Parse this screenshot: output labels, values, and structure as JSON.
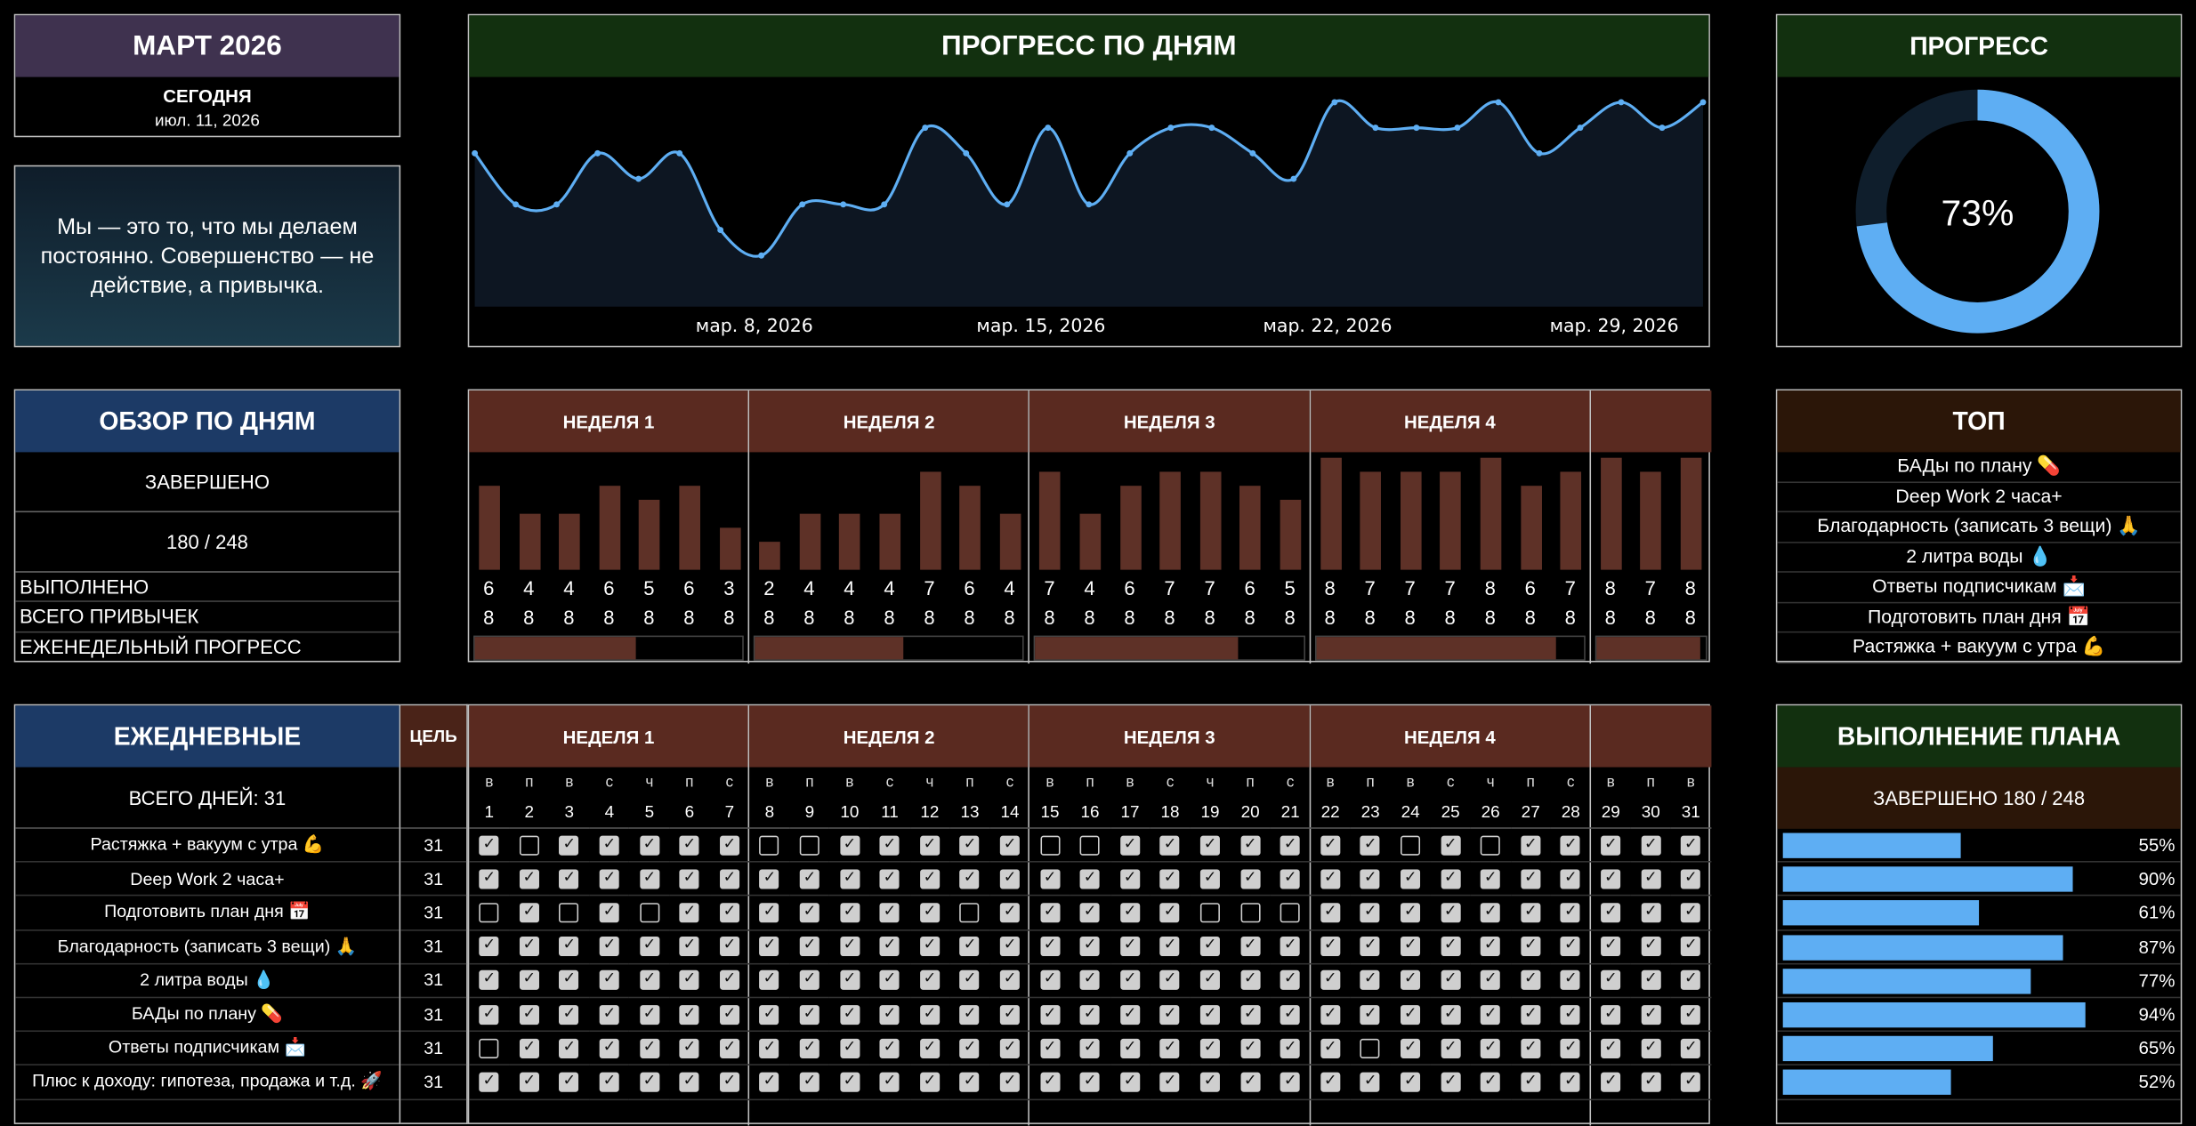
{
  "month": {
    "title": "МАРТ 2026",
    "today_label": "СЕГОДНЯ",
    "today_date": "июл. 11, 2026"
  },
  "quote": "Мы — это то, что мы делаем постоянно. Совершенство — не действие, а привычка.",
  "chart_data": {
    "type": "area",
    "title": "ПРОГРЕСС ПО ДНЯМ",
    "x": [
      1,
      2,
      3,
      4,
      5,
      6,
      7,
      8,
      9,
      10,
      11,
      12,
      13,
      14,
      15,
      16,
      17,
      18,
      19,
      20,
      21,
      22,
      23,
      24,
      25,
      26,
      27,
      28,
      29,
      30,
      31
    ],
    "values": [
      6,
      4,
      4,
      6,
      5,
      6,
      3,
      2,
      4,
      4,
      4,
      7,
      6,
      4,
      7,
      4,
      6,
      7,
      7,
      6,
      5,
      8,
      7,
      7,
      7,
      8,
      6,
      7,
      8,
      7,
      8
    ],
    "ylim": [
      0,
      8
    ],
    "tick_labels": [
      "мар. 8, 2026",
      "мар. 15, 2026",
      "мар. 22, 2026",
      "мар. 29, 2026"
    ],
    "color": "#5eaef3"
  },
  "progress": {
    "title": "ПРОГРЕСС",
    "value": 73,
    "label": "73%"
  },
  "overview": {
    "title": "ОБЗОР ПО ДНЯМ",
    "completed_label": "ЗАВЕРШЕНО",
    "completed_value": "180 / 248",
    "done_label": "ВЫПОЛНЕНО",
    "total_label": "ВСЕГО ПРИВЫЧЕК",
    "weekly_label": "ЕЖЕНЕДЕЛЬНЫЙ ПРОГРЕСС"
  },
  "weeks": [
    {
      "label": "НЕДЕЛЯ 1"
    },
    {
      "label": "НЕДЕЛЯ 2"
    },
    {
      "label": "НЕДЕЛЯ 3"
    },
    {
      "label": "НЕДЕЛЯ 4"
    },
    {
      "label": ""
    }
  ],
  "week_progress": [
    0.6,
    0.55,
    0.75,
    0.89,
    0.96
  ],
  "top": {
    "title": "ТОП",
    "items": [
      "БАДы по плану 💊",
      "Deep Work 2 часа+",
      "Благодарность (записать 3 вещи) 🙏",
      "2 литра воды 💧",
      "Ответы подписчикам 📩",
      "Подготовить план дня 📅",
      "Растяжка + вакуум с утра 💪"
    ]
  },
  "daily": {
    "title": "ЕЖЕДНЕВНЫЕ",
    "goal_title": "ЦЕЛЬ",
    "days_label": "ВСЕГО ДНЕЙ:  31",
    "habits": [
      {
        "name": "Растяжка + вакуум с утра 💪",
        "goal": "31",
        "checks": "1011111001111100111111101011111"
      },
      {
        "name": "Deep Work 2 часа+",
        "goal": "31",
        "checks": "1111111111111111111111111111111"
      },
      {
        "name": "Подготовить план дня 📅",
        "goal": "31",
        "checks": "0101011111110111110001111111111"
      },
      {
        "name": "Благодарность (записать 3 вещи) 🙏",
        "goal": "31",
        "checks": "1111111111111111111111111111111"
      },
      {
        "name": "2 литра воды 💧",
        "goal": "31",
        "checks": "1111111111111111111111111111111"
      },
      {
        "name": "БАДы по плану 💊",
        "goal": "31",
        "checks": "1111111111111111111111111111111"
      },
      {
        "name": "Ответы подписчикам 📩",
        "goal": "31",
        "checks": "0111111111111111111111011111111"
      },
      {
        "name": "Плюс к доходу: гипотеза, продажа и т.д. 🚀",
        "goal": "31",
        "checks": "1111111111111111111111111111111"
      }
    ],
    "weekday_letters": [
      "в",
      "п",
      "в",
      "с",
      "ч",
      "п",
      "с"
    ]
  },
  "plan": {
    "title": "ВЫПОЛНЕНИЕ ПЛАНА",
    "completed_label": "ЗАВЕРШЕНО  180 / 248",
    "rows": [
      {
        "pct": 55,
        "label": "55%"
      },
      {
        "pct": 90,
        "label": "90%"
      },
      {
        "pct": 61,
        "label": "61%"
      },
      {
        "pct": 87,
        "label": "87%"
      },
      {
        "pct": 77,
        "label": "77%"
      },
      {
        "pct": 94,
        "label": "94%"
      },
      {
        "pct": 65,
        "label": "65%"
      },
      {
        "pct": 52,
        "label": "52%"
      }
    ]
  }
}
